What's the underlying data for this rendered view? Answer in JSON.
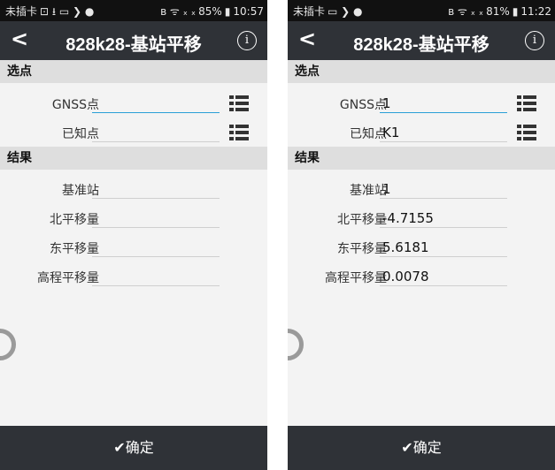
{
  "screens": [
    {
      "status": {
        "carrier": "未插卡",
        "left_icons": "⊡ ⭳ ▭ ❯ ●",
        "right_icons": "ʙ ᯤ ₓ ₓ",
        "battery": "85%",
        "time": "10:57"
      },
      "title": "828k28-基站平移",
      "section_select": "选点",
      "gnss_label": "GNSS点",
      "gnss_value": "",
      "known_label": "已知点",
      "known_value": "",
      "section_result": "结果",
      "base_label": "基准站",
      "base_value": "",
      "north_label": "北平移量",
      "north_value": "",
      "east_label": "东平移量",
      "east_value": "",
      "elev_label": "高程平移量",
      "elev_value": "",
      "confirm": "✔确定"
    },
    {
      "status": {
        "carrier": "未插卡",
        "left_icons": "▭ ❯ ●",
        "right_icons": "ʙ ᯤ ₓ ₓ",
        "battery": "81%",
        "time": "11:22"
      },
      "title": "828k28-基站平移",
      "section_select": "选点",
      "gnss_label": "GNSS点",
      "gnss_value": "1",
      "known_label": "已知点",
      "known_value": "K1",
      "section_result": "结果",
      "base_label": "基准站",
      "base_value": "1",
      "north_label": "北平移量",
      "north_value": "-4.7155",
      "east_label": "东平移量",
      "east_value": "5.6181",
      "elev_label": "高程平移量",
      "elev_value": "0.0078",
      "confirm": "✔确定"
    }
  ]
}
